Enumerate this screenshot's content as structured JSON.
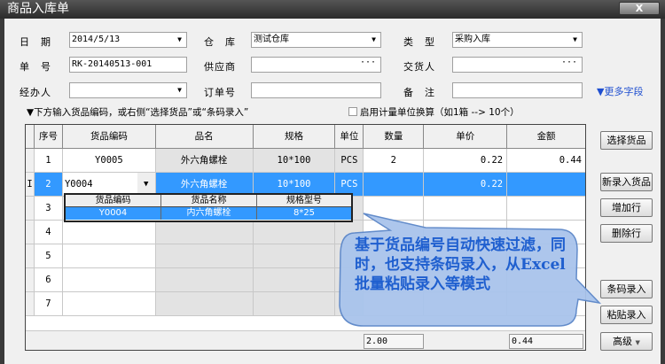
{
  "window": {
    "title": "商品入库单",
    "close_label": "X"
  },
  "form": {
    "date": {
      "label": "日　期",
      "value": "2014/5/13"
    },
    "warehouse": {
      "label": "仓　库",
      "value": "测试仓库"
    },
    "type": {
      "label": "类　型",
      "value": "采购入库"
    },
    "order_no": {
      "label": "单　号",
      "value": "RK-20140513-001"
    },
    "supplier": {
      "label": "供应商",
      "value": ""
    },
    "deliverer": {
      "label": "交货人",
      "value": ""
    },
    "handler": {
      "label": "经办人",
      "value": ""
    },
    "po_no": {
      "label": "订单号",
      "value": ""
    },
    "remark": {
      "label": "备　注",
      "value": ""
    },
    "more_fields": "▼更多字段"
  },
  "hint": "▼下方输入货品编码，或右侧“选择货品”或“条码录入”",
  "unit_conversion_label": "启用计量单位换算（如1箱 --> 10个）",
  "table": {
    "headers": [
      "序号",
      "货品编码",
      "品名",
      "规格",
      "单位",
      "数量",
      "单价",
      "金额"
    ],
    "rows": [
      {
        "no": "1",
        "code": "Y0005",
        "name": "外六角螺栓",
        "spec": "10*100",
        "unit": "PCS",
        "qty": "2",
        "price": "0.22",
        "amount": "0.44"
      },
      {
        "no": "2",
        "code": "Y0004",
        "name": "外六角螺栓",
        "spec": "10*100",
        "unit": "PCS",
        "qty": "",
        "price": "0.22",
        "amount": "",
        "indicator": "I"
      },
      {
        "no": "3"
      },
      {
        "no": "4"
      },
      {
        "no": "5"
      },
      {
        "no": "6"
      },
      {
        "no": "7"
      }
    ],
    "totals": {
      "qty": "2.00",
      "amount": "0.44"
    }
  },
  "popup": {
    "headers": [
      "货品编码",
      "货品名称",
      "规格型号"
    ],
    "row": [
      "Y0004",
      "内六角螺栓",
      "8*25"
    ]
  },
  "buttons": {
    "select": "选择货品",
    "new_item": "新录入货品",
    "add_row": "增加行",
    "del_row": "删除行",
    "barcode": "条码录入",
    "paste": "粘贴录入",
    "advanced": "高级"
  },
  "callout": "基于货品编号自动快速过滤，同时，也支持条码录入，从Excel批量粘贴录入等模式"
}
